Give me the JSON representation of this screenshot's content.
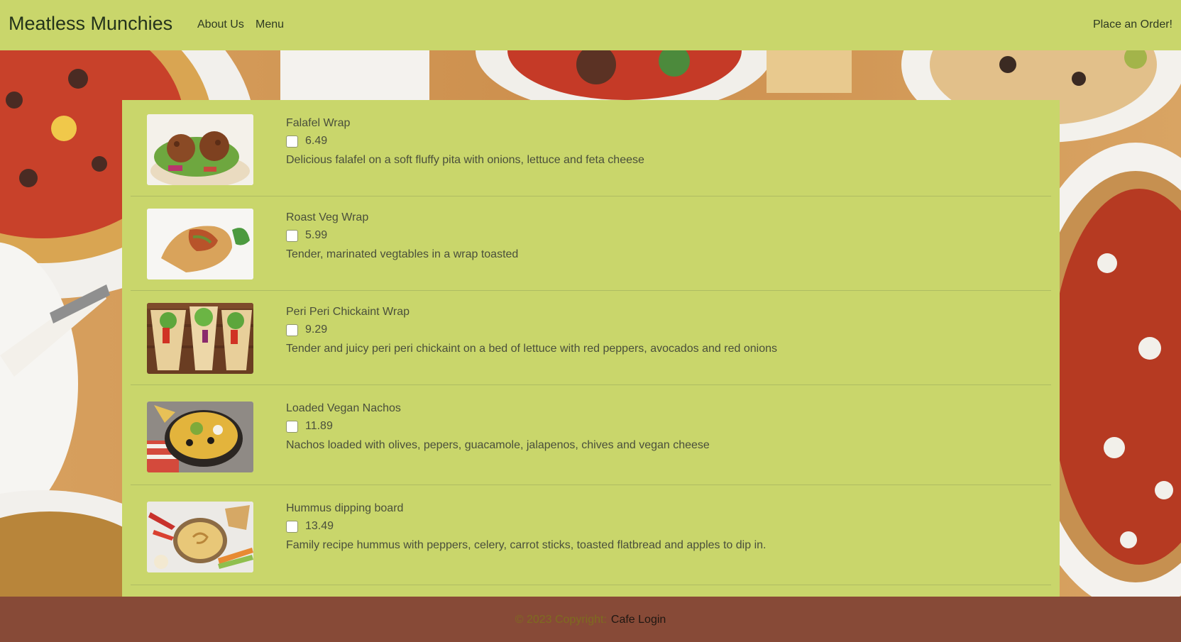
{
  "navbar": {
    "brand": "Meatless Munchies",
    "links": [
      "About Us",
      "Menu"
    ],
    "order_link": "Place an Order!"
  },
  "menu_items": [
    {
      "name": "Falafel Wrap",
      "price": "6.49",
      "description": "Delicious falafel on a soft fluffy pita with onions, lettuce and feta cheese",
      "checked": false
    },
    {
      "name": "Roast Veg Wrap",
      "price": "5.99",
      "description": "Tender, marinated vegtables in a wrap toasted",
      "checked": false
    },
    {
      "name": "Peri Peri Chickaint Wrap",
      "price": "9.29",
      "description": "Tender and juicy peri peri chickaint on a bed of lettuce with red peppers, avocados and red onions",
      "checked": false
    },
    {
      "name": "Loaded Vegan Nachos",
      "price": "11.89",
      "description": "Nachos loaded with olives, pepers, guacamole, jalapenos, chives and vegan cheese",
      "checked": false
    },
    {
      "name": "Hummus dipping board",
      "price": "13.49",
      "description": "Family recipe hummus with peppers, celery, carrot sticks, toasted flatbread and apples to dip in.",
      "checked": false
    }
  ],
  "footer": {
    "copyright": "© 2023 Copyright:",
    "login_link": "Cafe Login"
  },
  "colors": {
    "navbar_bg": "#c9d66b",
    "panel_bg": "#c9d66b",
    "footer_bg": "#874a37",
    "text": "#4a4f3b"
  }
}
